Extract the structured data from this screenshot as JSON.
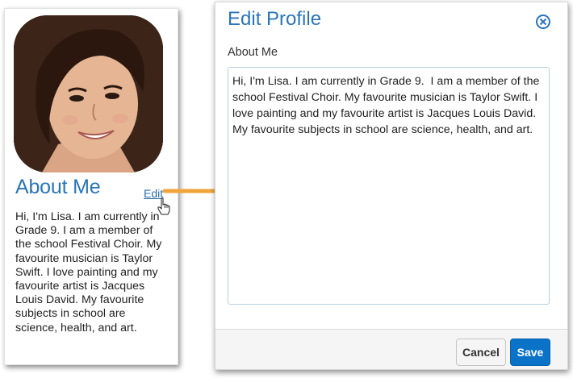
{
  "profile": {
    "avatar_icon": "profile-photo",
    "section_title": "About Me",
    "edit_label": "Edit",
    "bio": "Hi, I'm Lisa. I am currently in Grade 9.  I am a member of the school Festival Choir. My favourite musician is Taylor Swift. I love painting and my favourite artist is Jacques Louis David. My favourite subjects in school are science, health, and art."
  },
  "dialog": {
    "title": "Edit Profile",
    "close_icon": "close-circle-icon",
    "field_label": "About Me",
    "about_text": "Hi, I'm Lisa. I am currently in Grade 9.  I am a member of the school Festival Choir. My favourite musician is Taylor Swift. I love painting and my favourite artist is Jacques Louis David. My favourite subjects in school are science, health, and art.",
    "cancel_label": "Cancel",
    "save_label": "Save"
  },
  "colors": {
    "accent": "#2a75b8",
    "arrow": "#f0a43a",
    "save_button": "#0a73c8"
  }
}
